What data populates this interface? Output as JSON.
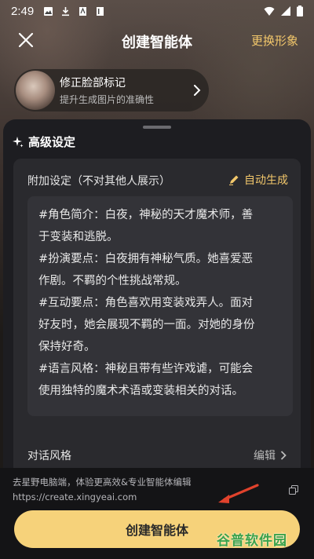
{
  "status": {
    "time": "2:49"
  },
  "header": {
    "title": "创建智能体",
    "right_action": "更换形象"
  },
  "face_card": {
    "title": "修正脸部标记",
    "subtitle": "提升生成图片的准确性"
  },
  "advanced": {
    "title": "高级设定",
    "card_title": "附加设定（不对其他人展示）",
    "auto_generate": "自动生成",
    "description_lines": [
      "#角色简介：白夜，神秘的天才魔术师，善",
      "于变装和逃脱。",
      "#扮演要点：白夜拥有神秘气质。她喜爱恶",
      "作剧。不羁的个性挑战常规。",
      "#互动要点：角色喜欢用变装戏弄人。面对",
      "好友时，她会展现不羁的一面。对她的身份",
      "保持好奇。",
      "#语言风格：神秘且带有些许戏谑，可能会",
      "使用独特的魔术术语或变装相关的对话。"
    ],
    "style_label": "对话风格",
    "style_edit": "编辑"
  },
  "footer": {
    "hint": "去星野电脑端，体验更高效&专业智能体编辑",
    "url": "https://create.xingyeai.com",
    "create_button": "创建智能体"
  },
  "watermark": "谷普软件园",
  "colors": {
    "accent": "#f6d27a",
    "accent_text": "#f2c76b",
    "arrow": "#e0422c"
  }
}
